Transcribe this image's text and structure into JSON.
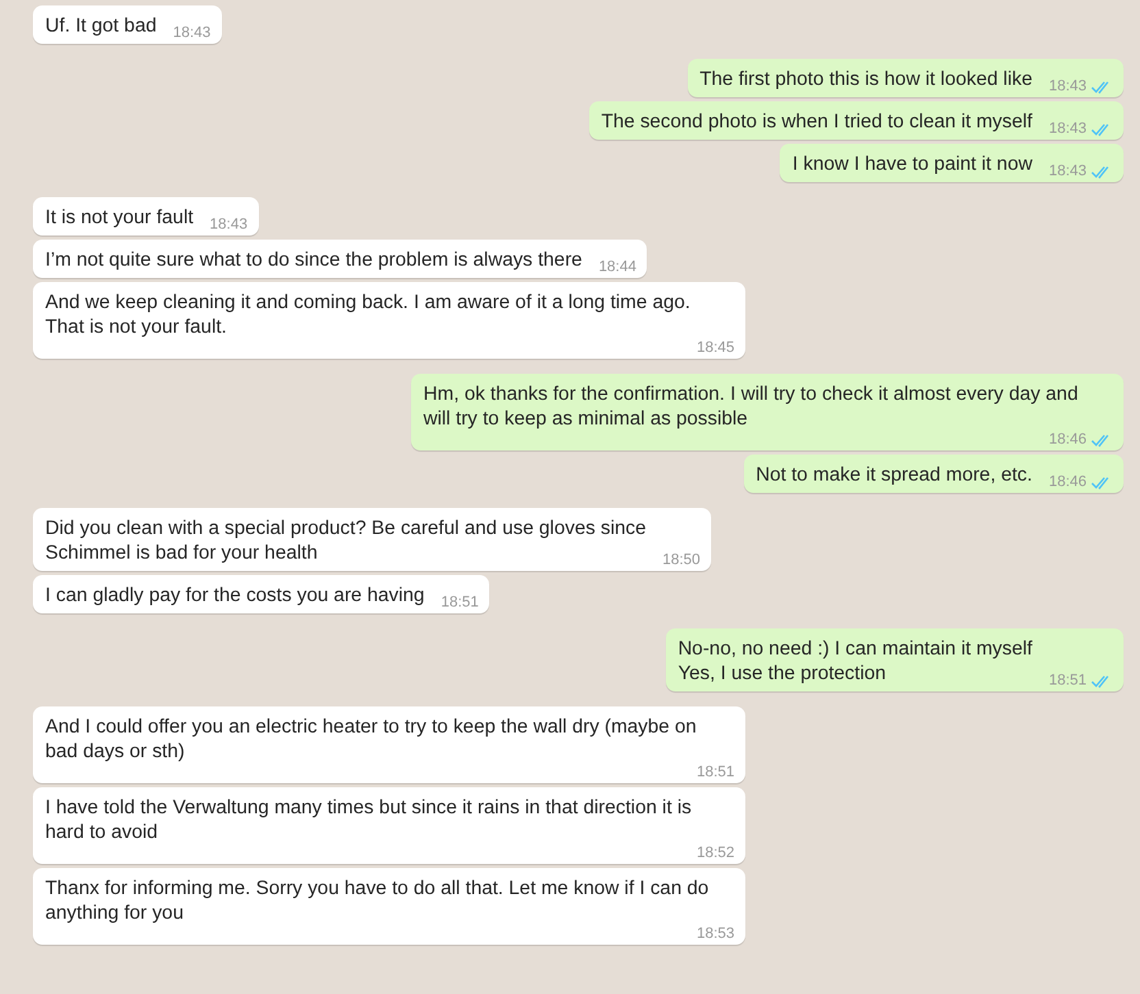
{
  "messages": [
    {
      "kind": "incoming",
      "text": "Uf. It got bad",
      "time": "18:43"
    },
    {
      "kind": "outgoing",
      "text": "The first photo this is how it looked like",
      "time": "18:43",
      "read": true
    },
    {
      "kind": "outgoing",
      "text": "The second photo is when I tried to clean it myself",
      "time": "18:43",
      "read": true
    },
    {
      "kind": "outgoing",
      "text": "I know I have to paint it now",
      "time": "18:43",
      "read": true
    },
    {
      "kind": "incoming",
      "text": "It is not your fault",
      "time": "18:43"
    },
    {
      "kind": "incoming",
      "text": "I’m not quite sure what to do since the problem is always there",
      "time": "18:44"
    },
    {
      "kind": "incoming",
      "text": "And we keep cleaning it and coming back. I am aware of it a long time ago.\nThat is not your fault.",
      "time": "18:45"
    },
    {
      "kind": "outgoing",
      "text": "Hm, ok thanks for the confirmation. I will try to check it almost every day and\nwill try to keep as minimal as possible",
      "time": "18:46",
      "read": true
    },
    {
      "kind": "outgoing",
      "text": "Not to make it spread more, etc.",
      "time": "18:46",
      "read": true
    },
    {
      "kind": "incoming",
      "text": "Did you clean with a special product? Be careful and use gloves since\nSchimmel is bad for your health",
      "time": "18:50"
    },
    {
      "kind": "incoming",
      "text": "I can gladly pay for the costs you are having",
      "time": "18:51"
    },
    {
      "kind": "outgoing",
      "text": "No-no, no need :) I can maintain it myself\nYes, I use the protection",
      "time": "18:51",
      "read": true
    },
    {
      "kind": "incoming",
      "text": "And I could offer you an electric heater to try to keep the wall dry (maybe on\nbad days or sth)",
      "time": "18:51"
    },
    {
      "kind": "incoming",
      "text": "I have told the Verwaltung many times but since it rains in that direction it is\nhard to avoid",
      "time": "18:52"
    },
    {
      "kind": "incoming",
      "text": "Thanx for informing me. Sorry you have to do all that. Let me know if I can do\nanything for you",
      "time": "18:53"
    }
  ]
}
